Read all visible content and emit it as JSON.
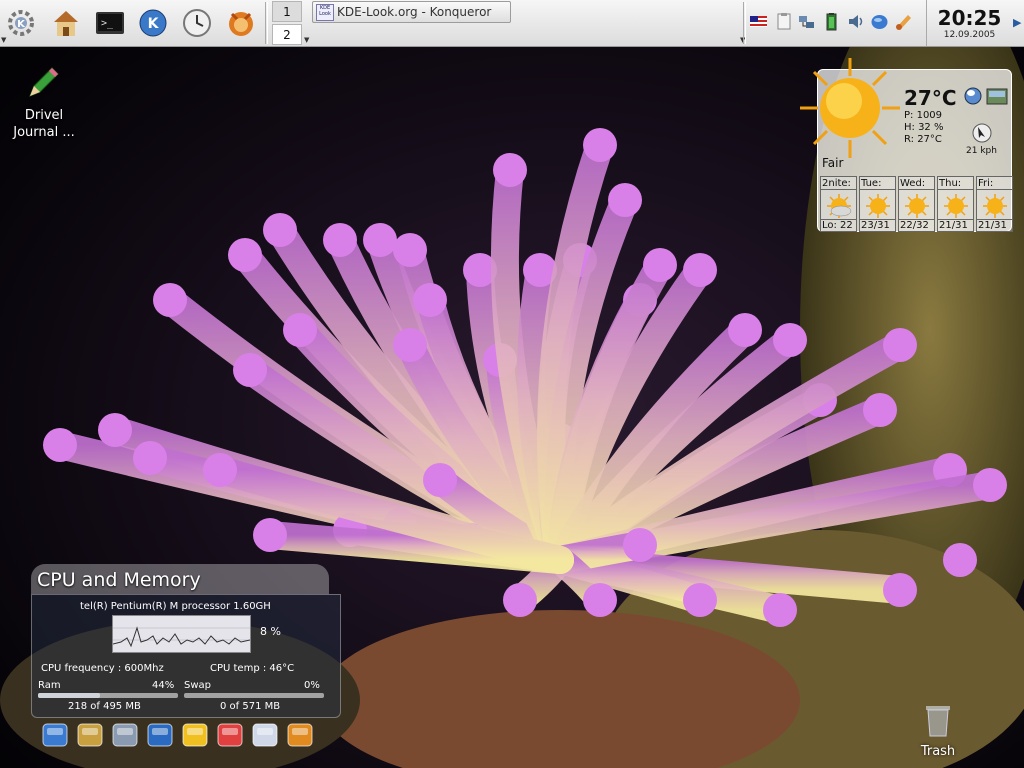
{
  "panel": {
    "launchers": [
      {
        "name": "kde-menu",
        "icon": "kde-gear-icon"
      },
      {
        "name": "home",
        "icon": "home-folder-icon"
      },
      {
        "name": "terminal",
        "icon": "konsole-icon"
      },
      {
        "name": "konqueror",
        "icon": "konqueror-k-icon"
      },
      {
        "name": "kontact",
        "icon": "clock-icon"
      },
      {
        "name": "firefox",
        "icon": "firefox-icon"
      }
    ],
    "pager": [
      "1",
      "2"
    ],
    "taskbar": {
      "title": "KDE-Look.org - Konqueror",
      "icon_text": "KDE Look"
    },
    "tray": [
      "us-flag-icon",
      "klipper-icon",
      "network-icon",
      "battery-icon",
      "volume-icon",
      "globe-icon",
      "audio-player-icon"
    ],
    "clock": {
      "time": "20:25",
      "date": "12.09.2005"
    }
  },
  "desktop": {
    "icons": [
      {
        "label": "Drivel Journal ...",
        "icon": "pencil-icon"
      },
      {
        "label": "Trash",
        "icon": "trash-icon"
      }
    ]
  },
  "weather": {
    "temp": "27°C",
    "pressure": "P: 1009",
    "humidity": "H: 32 %",
    "realfeel": "R: 27°C",
    "condition": "Fair",
    "wind": "21 kph",
    "forecast": [
      {
        "day": "2nite:",
        "temp": "Lo: 22",
        "icon": "partly-cloudy-icon"
      },
      {
        "day": "Tue:",
        "temp": "23/31",
        "icon": "sun-icon"
      },
      {
        "day": "Wed:",
        "temp": "22/32",
        "icon": "sun-icon"
      },
      {
        "day": "Thu:",
        "temp": "21/31",
        "icon": "sun-icon"
      },
      {
        "day": "Fri:",
        "temp": "21/31",
        "icon": "sun-icon"
      }
    ]
  },
  "cpu_widget": {
    "title": "CPU and Memory",
    "processor": "tel(R) Pentium(R) M processor 1.60GH",
    "cpu_usage": "8 %",
    "cpu_freq": "CPU frequency : 600Mhz",
    "cpu_temp": "CPU temp : 46°C",
    "ram_label": "Ram",
    "ram_percent": "44%",
    "ram_fraction": 0.44,
    "ram_usage": "218 of 495 MB",
    "swap_label": "Swap",
    "swap_percent": "0%",
    "swap_fraction": 0.0,
    "swap_usage": "0 of 571 MB"
  },
  "dock": [
    "monitor-icon",
    "wifi-icon",
    "harddisk-icon",
    "globe-icon",
    "alarm-clock-icon",
    "calendar-icon",
    "email-icon",
    "trash-bin-icon"
  ],
  "colors": {
    "panel": "#e8e8e8",
    "accent": "#3a6ea5"
  }
}
